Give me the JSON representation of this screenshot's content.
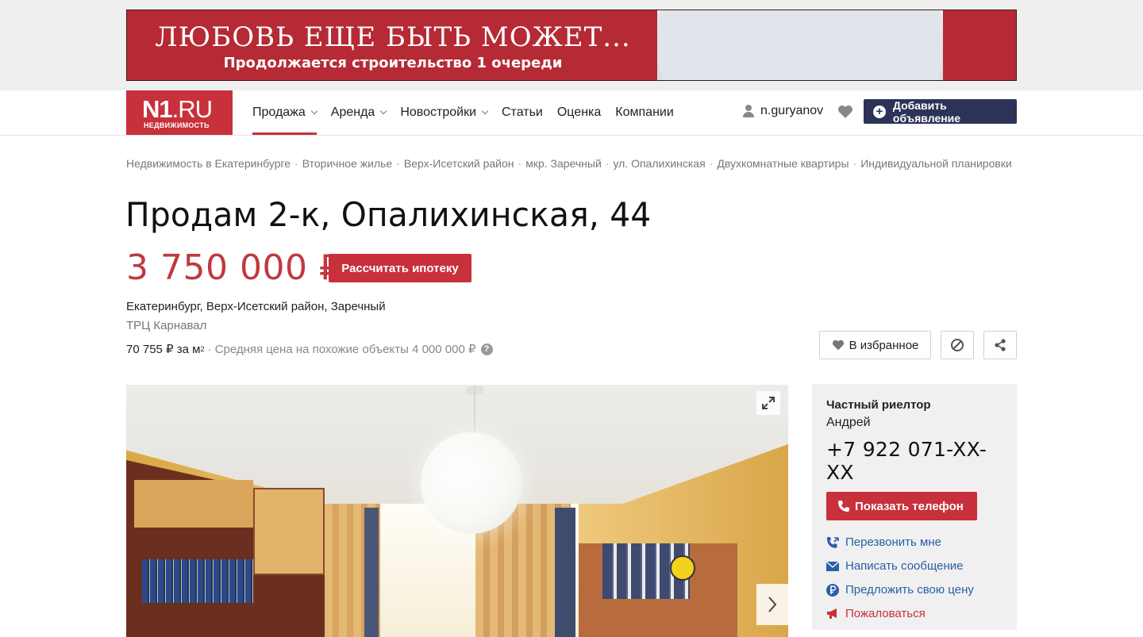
{
  "banner": {
    "headline": "ЛЮБОВЬ ЕЩЕ БЫТЬ МОЖЕТ...",
    "subline": "Продолжается строительство 1 очереди"
  },
  "logo": {
    "main": "N1",
    "suffix": ".RU",
    "sub": "НЕДВИЖИМОСТЬ"
  },
  "nav": {
    "items": [
      {
        "label": "Продажа",
        "dropdown": true,
        "active": true
      },
      {
        "label": "Аренда",
        "dropdown": true
      },
      {
        "label": "Новостройки",
        "dropdown": true
      },
      {
        "label": "Статьи"
      },
      {
        "label": "Оценка"
      },
      {
        "label": "Компании"
      }
    ],
    "username": "n.guryanov",
    "add_button": "Добавить объявление"
  },
  "breadcrumb": [
    "Недвижимость в Екатеринбурге",
    "Вторичное жилье",
    "Верх-Исетский район",
    "мкр. Заречный",
    "ул. Опалихинская",
    "Двухкомнатные квартиры",
    "Индивидуальной планировки"
  ],
  "listing": {
    "title": "Продам 2-к, Опалихинская, 44",
    "price": "3 750 000 ₽",
    "mortgage_button": "Рассчитать ипотеку",
    "address": "Екатеринбург, Верх-Исетский район, Заречный",
    "landmark": "ТРЦ Карнавал",
    "price_per_m": "70 755 ₽ за м",
    "price_per_m_sup": "2",
    "avg_price": "· Средняя цена на похожие объекты 4 000 000 ₽",
    "help_mark": "?",
    "favorite_button": "В избранное"
  },
  "seller": {
    "type": "Частный риелтор",
    "name": "Андрей",
    "phone": "+7 922 071-XX-XX",
    "show_phone_button": "Показать телефон",
    "actions": [
      {
        "label": "Перезвонить мне",
        "icon": "callback-icon"
      },
      {
        "label": "Написать сообщение",
        "icon": "envelope-icon"
      },
      {
        "label": "Предложить свою цену",
        "icon": "ruble-icon"
      },
      {
        "label": "Пожаловаться",
        "icon": "megaphone-icon"
      }
    ]
  },
  "colors": {
    "brand_red": "#c8303b",
    "nav_dark": "#2c3357",
    "link_blue": "#2a5ea8"
  }
}
